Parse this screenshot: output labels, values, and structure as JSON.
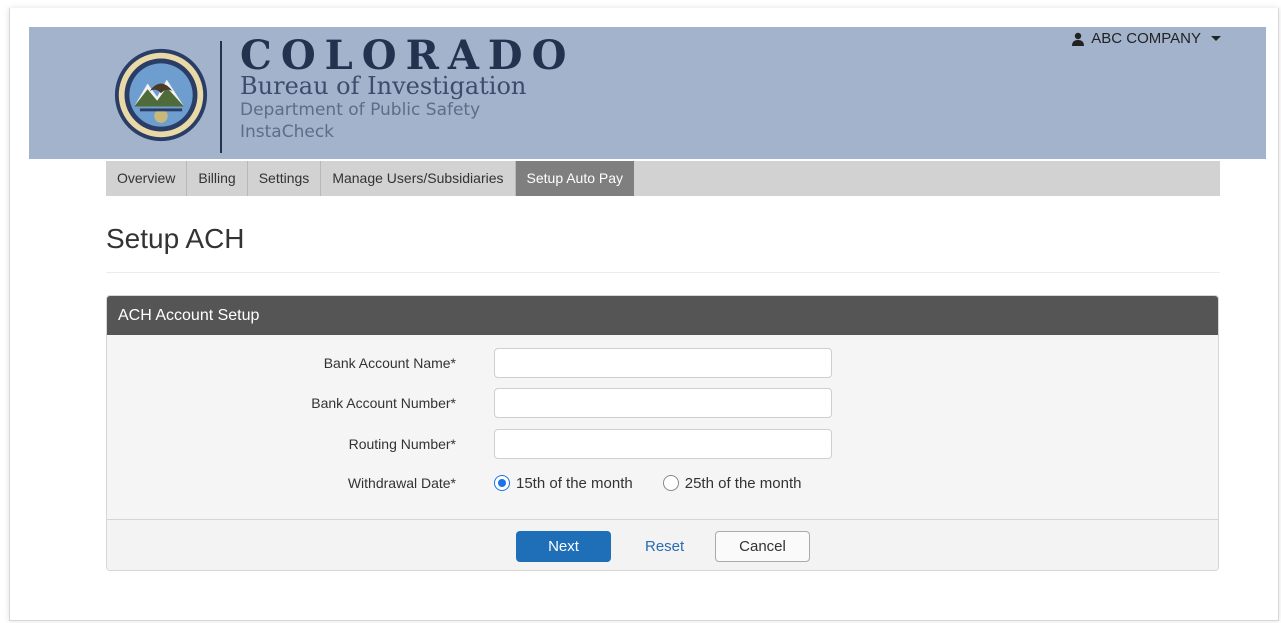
{
  "header": {
    "brand_line1": "COLORADO",
    "brand_line2": "Bureau of Investigation",
    "brand_line3": "Department of Public Safety",
    "brand_line4": "InstaCheck",
    "seal_icon": "state-seal-icon",
    "user_menu_label": "ABC COMPANY",
    "colors": {
      "banner": "#a3b3cc",
      "brand_text": "#23324f"
    }
  },
  "nav": {
    "tabs": [
      {
        "label": "Overview",
        "active": false
      },
      {
        "label": "Billing",
        "active": false
      },
      {
        "label": "Settings",
        "active": false
      },
      {
        "label": "Manage Users/Subsidiaries",
        "active": false
      },
      {
        "label": "Setup Auto Pay",
        "active": true
      }
    ]
  },
  "page": {
    "title": "Setup ACH"
  },
  "form": {
    "panel_title": "ACH Account Setup",
    "fields": {
      "bank_account_name": {
        "label": "Bank Account Name*",
        "value": ""
      },
      "bank_account_number": {
        "label": "Bank Account Number*",
        "value": ""
      },
      "routing_number": {
        "label": "Routing Number*",
        "value": ""
      }
    },
    "withdrawal": {
      "label": "Withdrawal Date*",
      "options": [
        {
          "label": "15th of the month",
          "selected": true
        },
        {
          "label": "25th of the month",
          "selected": false
        }
      ]
    },
    "actions": {
      "next_label": "Next",
      "reset_label": "Reset",
      "cancel_label": "Cancel"
    },
    "colors": {
      "panel_header": "#555555",
      "primary_button": "#1e6fb8"
    }
  }
}
